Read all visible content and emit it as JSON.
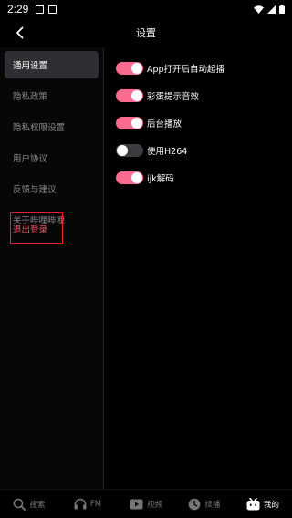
{
  "status_bar": {
    "time": "2:29"
  },
  "header": {
    "title": "设置",
    "back_icon": "chevron-left-icon"
  },
  "sidebar": {
    "items": [
      {
        "label": "通用设置",
        "active": true
      },
      {
        "label": "隐私政策"
      },
      {
        "label": "隐私权限设置"
      },
      {
        "label": "用户协议"
      },
      {
        "label": "反馈与建议"
      },
      {
        "label": "关于哔哩哔哩"
      }
    ],
    "logout_label": "退出登录"
  },
  "settings": [
    {
      "label": "App打开后自动起播",
      "enabled": true
    },
    {
      "label": "彩蛋提示音效",
      "enabled": true
    },
    {
      "label": "后台播放",
      "enabled": true
    },
    {
      "label": "使用H264",
      "enabled": false
    },
    {
      "label": "ijk解码",
      "enabled": true
    }
  ],
  "bottom_nav": [
    {
      "label": "搜索",
      "icon": "search-icon"
    },
    {
      "label": "FM",
      "icon": "headphones-icon"
    },
    {
      "label": "视频",
      "icon": "video-icon"
    },
    {
      "label": "续播",
      "icon": "history-icon"
    },
    {
      "label": "我的",
      "icon": "bilibili-tv-icon",
      "active": true
    }
  ],
  "colors": {
    "accent_pink": "#fb6a8f",
    "toggle_off": "#3c3d42",
    "logout_highlight": "#ff1a1a",
    "logout_text": "#ff5a64"
  }
}
